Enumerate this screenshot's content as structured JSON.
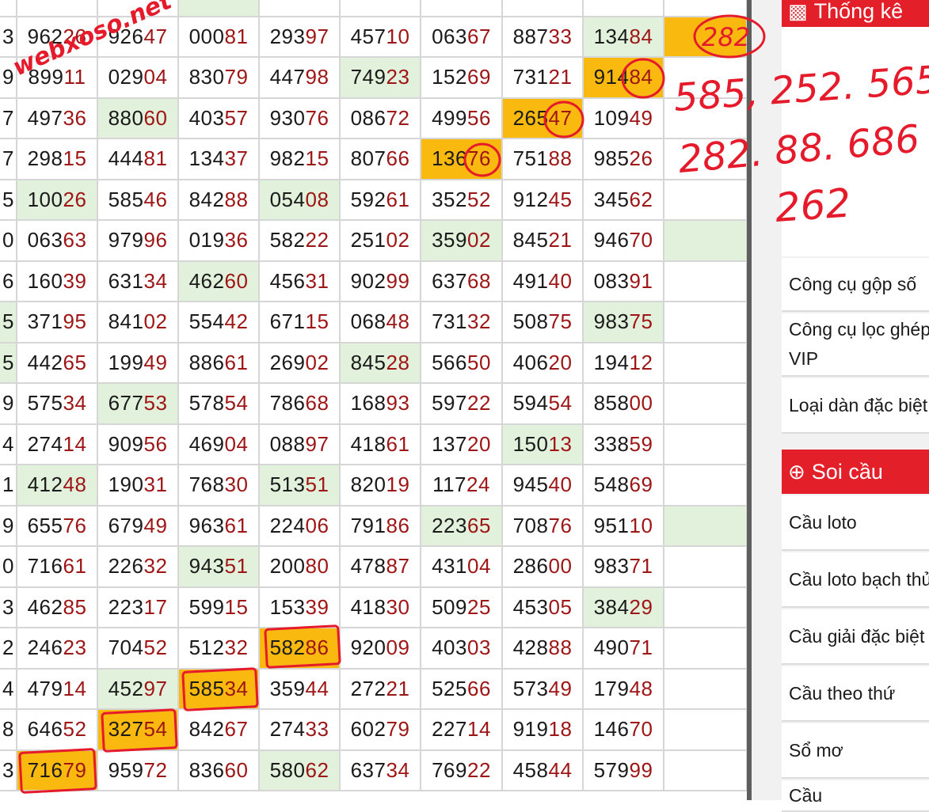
{
  "watermark": "webxoso.net",
  "handwriting": {
    "circled": "282",
    "line1": "585, 252. 565",
    "line2": "282. 88. 686",
    "line3": "262"
  },
  "grid": {
    "edge_top": "",
    "rows": [
      {
        "edge": "3",
        "cells": [
          "96226",
          "92647",
          "00081",
          "29397",
          "45710",
          "06367",
          "88733",
          "13484",
          ""
        ]
      },
      {
        "edge": "9",
        "cells": [
          "89911",
          "02904",
          "83079",
          "44798",
          "74923",
          "15269",
          "73121",
          "91484",
          ""
        ]
      },
      {
        "edge": "7",
        "cells": [
          "49736",
          "88060",
          "40357",
          "93076",
          "08672",
          "49956",
          "26547",
          "10949",
          ""
        ]
      },
      {
        "edge": "7",
        "cells": [
          "29815",
          "44481",
          "13437",
          "98215",
          "80766",
          "13676",
          "75188",
          "98526",
          ""
        ]
      },
      {
        "edge": "5",
        "cells": [
          "10026",
          "58546",
          "84288",
          "05408",
          "59261",
          "35252",
          "91245",
          "34562",
          ""
        ]
      },
      {
        "edge": "0",
        "cells": [
          "06363",
          "97996",
          "01936",
          "58222",
          "25102",
          "35902",
          "84521",
          "94670",
          ""
        ]
      },
      {
        "edge": "6",
        "cells": [
          "16039",
          "63134",
          "46260",
          "45631",
          "90299",
          "63768",
          "49140",
          "08391",
          ""
        ]
      },
      {
        "edge": "5",
        "cells": [
          "37195",
          "84102",
          "55442",
          "67115",
          "06848",
          "73132",
          "50875",
          "98375",
          ""
        ]
      },
      {
        "edge": "5",
        "cells": [
          "44265",
          "19949",
          "88661",
          "26902",
          "84528",
          "56650",
          "40620",
          "19412",
          ""
        ]
      },
      {
        "edge": "9",
        "cells": [
          "57534",
          "67753",
          "57854",
          "78668",
          "16893",
          "59722",
          "59454",
          "85800",
          ""
        ]
      },
      {
        "edge": "4",
        "cells": [
          "27414",
          "90956",
          "46904",
          "08897",
          "41861",
          "13720",
          "15013",
          "33859",
          ""
        ]
      },
      {
        "edge": "1",
        "cells": [
          "41248",
          "19031",
          "76830",
          "51351",
          "82019",
          "11724",
          "94540",
          "54869",
          ""
        ]
      },
      {
        "edge": "9",
        "cells": [
          "65576",
          "67949",
          "96361",
          "22406",
          "79186",
          "22365",
          "70876",
          "95110",
          ""
        ]
      },
      {
        "edge": "0",
        "cells": [
          "71661",
          "22632",
          "94351",
          "20080",
          "47887",
          "43104",
          "28600",
          "98371",
          ""
        ]
      },
      {
        "edge": "3",
        "cells": [
          "46285",
          "22317",
          "59915",
          "15339",
          "41830",
          "50925",
          "45305",
          "38429",
          ""
        ]
      },
      {
        "edge": "2",
        "cells": [
          "24623",
          "70452",
          "51232",
          "58286",
          "92009",
          "40303",
          "42888",
          "49071",
          ""
        ]
      },
      {
        "edge": "4",
        "cells": [
          "47914",
          "45297",
          "58534",
          "35944",
          "27221",
          "52566",
          "57349",
          "17948",
          ""
        ]
      },
      {
        "edge": "8",
        "cells": [
          "64652",
          "32754",
          "84267",
          "27433",
          "60279",
          "22714",
          "91918",
          "14670",
          ""
        ]
      },
      {
        "edge": "3",
        "cells": [
          "71679",
          "95972",
          "83660",
          "58062",
          "63734",
          "76922",
          "45844",
          "57999",
          ""
        ]
      }
    ]
  },
  "sidebar": {
    "stats_header": "Thống kê",
    "tools": [
      "Công cụ gộp số",
      "Công cụ lọc ghép VIP",
      "Loại dàn đặc biệt"
    ],
    "soi_cau_header": "Soi cầu",
    "soi_cau_items": [
      "Cầu loto",
      "Cầu loto bạch thủ",
      "Cầu giải đặc biệt",
      "Cầu theo thứ",
      "Sổ mơ",
      "Cầu"
    ]
  }
}
